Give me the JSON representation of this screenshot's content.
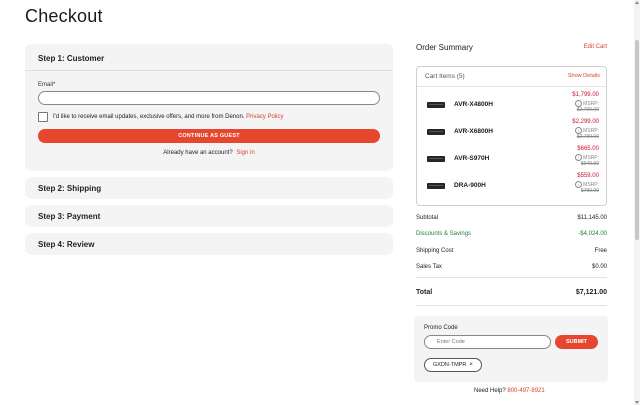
{
  "page": {
    "title": "Checkout"
  },
  "steps": {
    "customer": {
      "heading": "Step 1: Customer",
      "email_label": "Email*",
      "email_value": "",
      "optin_text": "I'd like to receive email updates, exclusive offers, and more from Denon.",
      "optin_link": "Privacy Policy",
      "optin_checked": false,
      "guest_button": "CONTINUE AS GUEST",
      "account_prompt": "Already have an account?",
      "signin_link": "Sign in"
    },
    "shipping": {
      "heading": "Step 2: Shipping"
    },
    "payment": {
      "heading": "Step 3: Payment"
    },
    "review": {
      "heading": "Step 4: Review"
    }
  },
  "summary": {
    "title": "Order Summary",
    "edit_cart": "Edit Cart",
    "cart_heading": "Cart Items (5)",
    "show_details": "Show Details",
    "msrp_label": "MSRP:",
    "items": [
      {
        "name": "AVR-X4800H",
        "price": "$1,799.00",
        "msrp": "$2,799.00"
      },
      {
        "name": "AVR-X6800H",
        "price": "$2,299.00",
        "msrp": "$3,799.00"
      },
      {
        "name": "AVR-S970H",
        "price": "$665.00",
        "msrp": "$949.00"
      },
      {
        "name": "DRA-900H",
        "price": "$559.00",
        "msrp": "$799.00"
      }
    ],
    "subtotal_label": "Subtotal",
    "subtotal_value": "$11,145.00",
    "discounts_label": "Discounts & Savings",
    "discounts_value": "-$4,024.00",
    "shipping_label": "Shipping Cost",
    "shipping_value": "Free",
    "tax_label": "Sales Tax",
    "tax_value": "$0.00",
    "total_label": "Total",
    "total_value": "$7,121.00"
  },
  "promo": {
    "label": "Promo Code",
    "placeholder": "Enter Code",
    "submit": "SUBMIT",
    "applied_code": "GXDN-TMPR",
    "remove_glyph": "×"
  },
  "help": {
    "text": "Need Help?",
    "phone": "800-497-8921"
  },
  "colors": {
    "accent": "#e8472f",
    "price": "#c8102e",
    "savings": "#1a7f37",
    "panel": "#f4f4f4"
  }
}
